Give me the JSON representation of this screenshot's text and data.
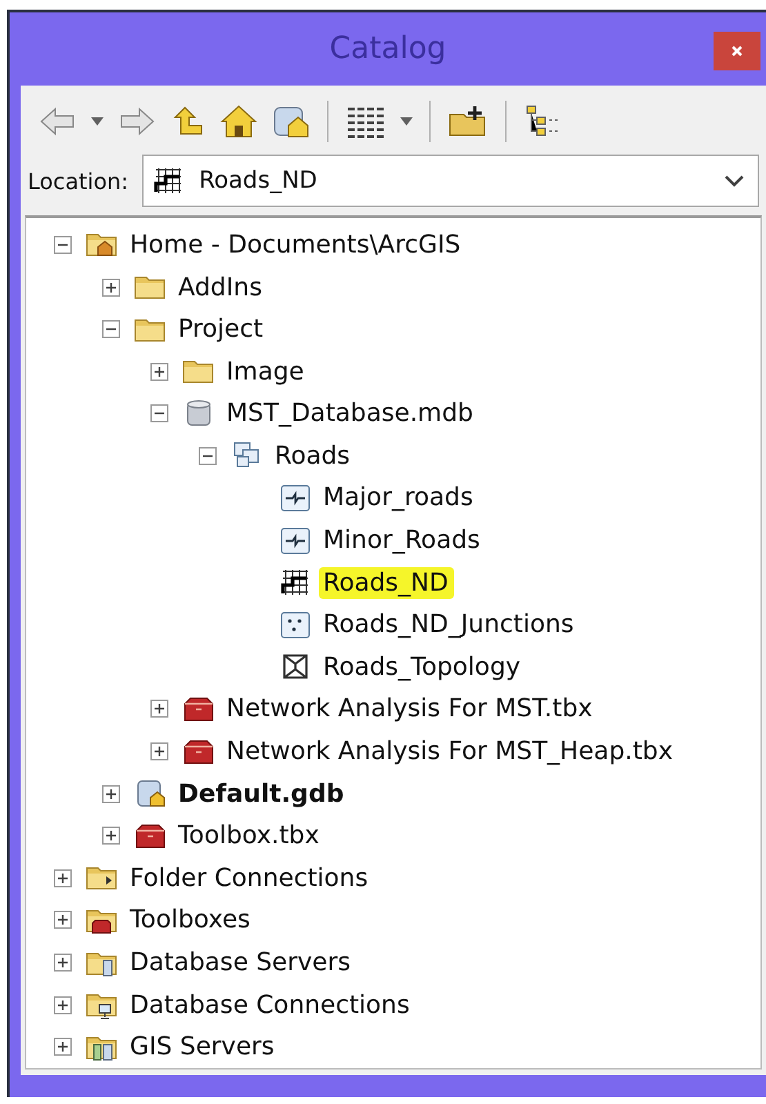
{
  "window": {
    "title": "Catalog"
  },
  "location": {
    "label": "Location:",
    "value": "Roads_ND"
  },
  "tree": [
    {
      "label": "Home - Documents\\ArcGIS",
      "kind": "home-folder",
      "expanded": true,
      "selected": false,
      "children": [
        {
          "label": "AddIns",
          "kind": "folder",
          "expanded": false,
          "selected": false
        },
        {
          "label": "Project",
          "kind": "folder",
          "expanded": true,
          "selected": false,
          "children": [
            {
              "label": "Image",
              "kind": "folder",
              "expanded": false,
              "selected": false
            },
            {
              "label": "MST_Database.mdb",
              "kind": "database",
              "expanded": true,
              "selected": false,
              "children": [
                {
                  "label": "Roads",
                  "kind": "feature-dataset",
                  "expanded": true,
                  "selected": false,
                  "children": [
                    {
                      "label": "Major_roads",
                      "kind": "line-class",
                      "selected": false
                    },
                    {
                      "label": "Minor_Roads",
                      "kind": "line-class",
                      "selected": false
                    },
                    {
                      "label": "Roads_ND",
                      "kind": "network",
                      "selected": true
                    },
                    {
                      "label": "Roads_ND_Junctions",
                      "kind": "point-class",
                      "selected": false
                    },
                    {
                      "label": "Roads_Topology",
                      "kind": "topology",
                      "selected": false
                    }
                  ]
                }
              ]
            },
            {
              "label": "Network Analysis For MST.tbx",
              "kind": "toolbox",
              "expanded": false,
              "selected": false
            },
            {
              "label": "Network Analysis For MST_Heap.tbx",
              "kind": "toolbox",
              "expanded": false,
              "selected": false
            }
          ]
        },
        {
          "label": "Default.gdb",
          "kind": "geodatabase",
          "expanded": false,
          "selected": false,
          "bold": true
        },
        {
          "label": "Toolbox.tbx",
          "kind": "toolbox",
          "expanded": false,
          "selected": false
        }
      ]
    },
    {
      "label": "Folder Connections",
      "kind": "folder-connections",
      "expanded": false,
      "selected": false
    },
    {
      "label": "Toolboxes",
      "kind": "toolboxes",
      "expanded": false,
      "selected": false
    },
    {
      "label": "Database Servers",
      "kind": "database-servers",
      "expanded": false,
      "selected": false
    },
    {
      "label": "Database Connections",
      "kind": "database-connections",
      "expanded": false,
      "selected": false
    },
    {
      "label": "GIS Servers",
      "kind": "gis-servers",
      "expanded": false,
      "selected": false
    }
  ]
}
